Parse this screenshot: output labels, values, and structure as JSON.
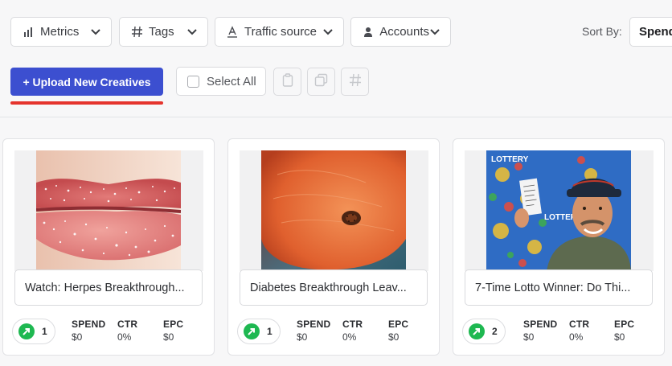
{
  "filters": {
    "metrics_label": "Metrics",
    "tags_label": "Tags",
    "traffic_label": "Traffic source",
    "accounts_label": "Accounts"
  },
  "sort": {
    "label": "Sort By:",
    "value": "Spend"
  },
  "actions": {
    "upload_label": "+ Upload New Creatives",
    "select_all_label": "Select All"
  },
  "cards": [
    {
      "title": "Watch: Herpes Breakthrough...",
      "count": "1",
      "metrics": [
        {
          "label": "SPEND",
          "value": "$0"
        },
        {
          "label": "CTR",
          "value": "0%"
        },
        {
          "label": "EPC",
          "value": "$0"
        }
      ]
    },
    {
      "title": "Diabetes Breakthrough Leav...",
      "count": "1",
      "metrics": [
        {
          "label": "SPEND",
          "value": "$0"
        },
        {
          "label": "CTR",
          "value": "0%"
        },
        {
          "label": "EPC",
          "value": "$0"
        }
      ]
    },
    {
      "title": "7-Time Lotto Winner: Do Thi...",
      "count": "2",
      "metrics": [
        {
          "label": "SPEND",
          "value": "$0"
        },
        {
          "label": "CTR",
          "value": "0%"
        },
        {
          "label": "EPC",
          "value": "$0"
        }
      ]
    }
  ],
  "colors": {
    "primary": "#3c4fd0",
    "underline": "#e5342d",
    "badge_green": "#1eb851"
  },
  "icons": [
    "bar-chart-icon",
    "hash-icon",
    "text-underline-icon",
    "user-icon",
    "chevron-down-icon",
    "clipboard-icon",
    "copy-icon",
    "trend-up-icon"
  ]
}
